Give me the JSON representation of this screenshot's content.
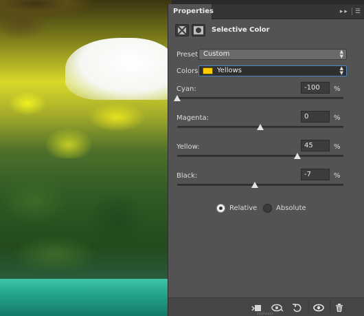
{
  "panel": {
    "tab_title": "Properties",
    "adjustment_title": "Selective Color",
    "tab_buttons": [
      "collapse-icon",
      "panel-menu-icon"
    ]
  },
  "preset": {
    "label": "Preset:",
    "value": "Custom"
  },
  "colors": {
    "label": "Colors:",
    "value": "Yellows",
    "swatch_color": "#ffcc00"
  },
  "sliders": [
    {
      "label": "Cyan:",
      "value": "-100",
      "unit": "%",
      "level": -100
    },
    {
      "label": "Magenta:",
      "value": "0",
      "unit": "%",
      "level": 0
    },
    {
      "label": "Yellow:",
      "value": "45",
      "unit": "%",
      "level": 45
    },
    {
      "label": "Black:",
      "value": "-7",
      "unit": "%",
      "level": -7
    }
  ],
  "method": {
    "options": [
      "Relative",
      "Absolute"
    ],
    "selected": "Relative"
  },
  "footer_icons": [
    "clip-to-layer-icon",
    "view-previous-state-icon",
    "reset-icon",
    "visibility-eye-icon",
    "trash-icon"
  ],
  "theme": {
    "panel_bg": "#535353",
    "accent_border": "#4a84c2"
  }
}
